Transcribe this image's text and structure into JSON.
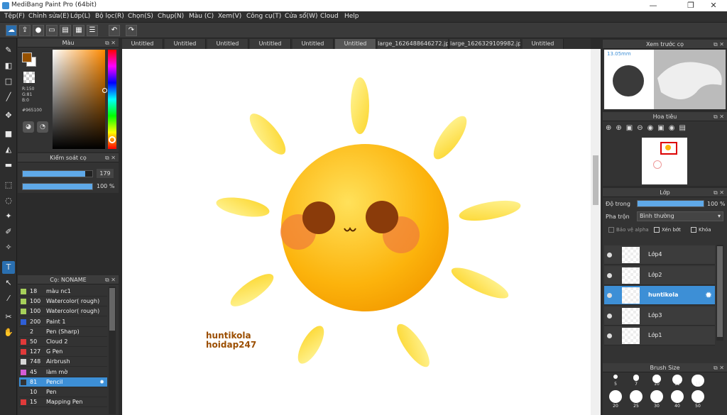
{
  "window": {
    "title": "MediBang Paint Pro (64bit)",
    "min": "—",
    "max": "❐",
    "close": "✕"
  },
  "menu": [
    "Tệp(F)",
    "Chỉnh sửa(E)",
    "Lớp(L)",
    "Bộ lọc(R)",
    "Chọn(S)",
    "Chụp(N)",
    "Màu (C)",
    "Xem(V)",
    "Công cụ(T)",
    "Cửa sổ(W)",
    "Cloud",
    "Help"
  ],
  "color_panel": {
    "title": "Màu",
    "r": "R:150",
    "g": "G:81",
    "b": "B:0",
    "hex": "#965100",
    "fg": "#965100",
    "bg": "#ffffff"
  },
  "brush_control": {
    "title": "Kiểm soát cọ",
    "size": "179",
    "opacity": "100 %",
    "size_frac": 0.9,
    "opacity_frac": 1.0
  },
  "brush_list": {
    "title": "Cọ: NONAME",
    "items": [
      {
        "size": "18",
        "name": "màu nc1",
        "color": "#a6d05a"
      },
      {
        "size": "100",
        "name": "Watercolor( rough)",
        "color": "#a6d05a"
      },
      {
        "size": "100",
        "name": "Watercolor( rough)",
        "color": "#a6d05a"
      },
      {
        "size": "200",
        "name": "Paint 1",
        "color": "#2f5fd6"
      },
      {
        "size": "2",
        "name": "Pen (Sharp)",
        "color": "#333333"
      },
      {
        "size": "50",
        "name": "Cloud 2",
        "color": "#e03a3a"
      },
      {
        "size": "127",
        "name": "G Pen",
        "color": "#e03a3a"
      },
      {
        "size": "748",
        "name": "Airbrush",
        "color": "#d6d6d6"
      },
      {
        "size": "45",
        "name": "làm mờ",
        "color": "#d65cd6"
      },
      {
        "size": "81",
        "name": "Pencil",
        "color": "#333333",
        "selected": true
      },
      {
        "size": "10",
        "name": "Pen",
        "color": "#333333"
      },
      {
        "size": "15",
        "name": "Mapping Pen",
        "color": "#e03a3a"
      }
    ]
  },
  "tabs": [
    {
      "label": "Untitled"
    },
    {
      "label": "Untitled"
    },
    {
      "label": "Untitled"
    },
    {
      "label": "Untitled"
    },
    {
      "label": "Untitled"
    },
    {
      "label": "Untitled",
      "selected": true
    },
    {
      "label": "large_1626488646272.jpg"
    },
    {
      "label": "large_1626329109982.jpg"
    },
    {
      "label": "Untitled"
    }
  ],
  "canvas": {
    "watermark_line1": "huntikola",
    "watermark_line2": "hoidap247"
  },
  "preview": {
    "title": "Xem trước cọ",
    "size": "13.05mm"
  },
  "navigator": {
    "title": "Hoa tiêu"
  },
  "layer_panel": {
    "title": "Lớp",
    "opacity_label": "Độ trong",
    "opacity_value": "100 %",
    "blend_label": "Pha trộn",
    "blend_value": "Bình thường",
    "protect_alpha": "Bảo vệ alpha",
    "clip": "Xén bớt",
    "lock": "Khóa",
    "layers": [
      {
        "name": "Lớp4"
      },
      {
        "name": "Lớp2"
      },
      {
        "name": "huntikola",
        "selected": true
      },
      {
        "name": "Lớp3"
      },
      {
        "name": "Lớp1"
      }
    ]
  },
  "brush_size": {
    "title": "Brush Size",
    "row1": [
      "5",
      "7",
      "10",
      "12",
      "15"
    ],
    "row2": [
      "20",
      "25",
      "30",
      "40",
      "50"
    ]
  }
}
